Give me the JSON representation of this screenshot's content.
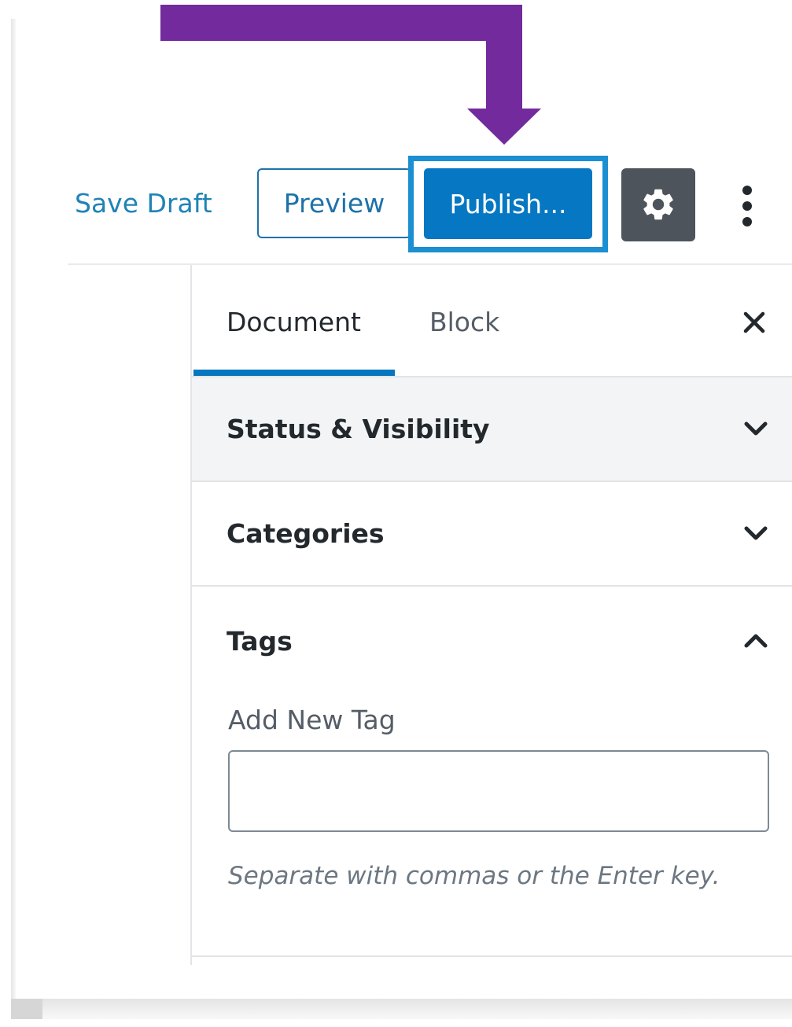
{
  "toolbar": {
    "save_draft_label": "Save Draft",
    "preview_label": "Preview",
    "publish_label": "Publish...",
    "settings_icon": "gear-icon",
    "more_icon": "vertical-ellipsis-icon"
  },
  "sidebar": {
    "tabs": [
      {
        "label": "Document",
        "active": true
      },
      {
        "label": "Block",
        "active": false
      }
    ],
    "close_icon": "close-icon",
    "panels": [
      {
        "title": "Status & Visibility",
        "expanded": false
      },
      {
        "title": "Categories",
        "expanded": false
      },
      {
        "title": "Tags",
        "expanded": true
      }
    ],
    "tags": {
      "field_label": "Add New Tag",
      "value": "",
      "help_text": "Separate with commas or the Enter key."
    }
  },
  "colors": {
    "annotation_arrow": "#722a9d",
    "primary": "#0677c3",
    "link": "#1f83b7",
    "highlight_frame": "#1b8fd1",
    "settings_bg": "#4d545b"
  }
}
